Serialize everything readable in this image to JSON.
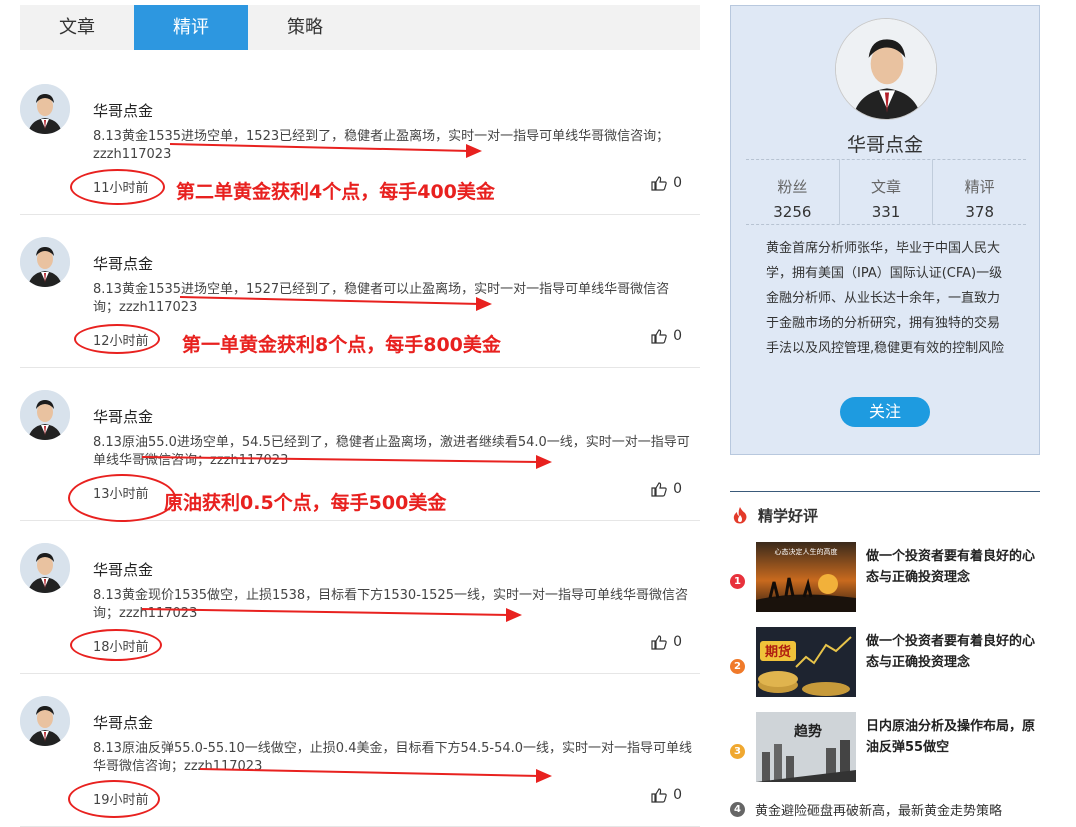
{
  "tabs": [
    "文章",
    "精评",
    "策略"
  ],
  "posts": [
    {
      "author": "华哥点金",
      "content": "8.13黄金1535进场空单，1523已经到了，稳健者止盈离场，实时一对一指导可单线华哥微信咨询；zzzh117023",
      "time": "11小时前",
      "likes": "0",
      "note": "第二单黄金获利4个点，每手400美金"
    },
    {
      "author": "华哥点金",
      "content": "8.13黄金1535进场空单，1527已经到了，稳健者可以止盈离场，实时一对一指导可单线华哥微信咨询；zzzh117023",
      "time": "12小时前",
      "likes": "0",
      "note": "第一单黄金获利8个点，每手800美金"
    },
    {
      "author": "华哥点金",
      "content": "8.13原油55.0进场空单，54.5已经到了，稳健者止盈离场，激进者继续看54.0一线，实时一对一指导可单线华哥微信咨询；zzzh117023",
      "time": "13小时前",
      "likes": "0",
      "note": "原油获利0.5个点，每手500美金"
    },
    {
      "author": "华哥点金",
      "content": "8.13黄金现价1535做空，止损1538，目标看下方1530-1525一线，实时一对一指导可单线华哥微信咨询；zzzh117023",
      "time": "18小时前",
      "likes": "0",
      "note": ""
    },
    {
      "author": "华哥点金",
      "content": "8.13原油反弹55.0-55.10一线做空，止损0.4美金，目标看下方54.5-54.0一线，实时一对一指导可单线华哥微信咨询；zzzh117023",
      "time": "19小时前",
      "likes": "0",
      "note": ""
    }
  ],
  "profile": {
    "name": "华哥点金",
    "stats": [
      {
        "label": "粉丝",
        "value": "3256"
      },
      {
        "label": "文章",
        "value": "331"
      },
      {
        "label": "精评",
        "value": "378"
      }
    ],
    "bio": "黄金首席分析师张华，毕业于中国人民大学，拥有美国（IPA）国际认证(CFA)一级金融分析师、从业长达十余年，一直致力于金融市场的分析研究，拥有独特的交易手法以及风控管理,稳健更有效的控制风险",
    "follow_label": "关注"
  },
  "hot": {
    "title": "精学好评",
    "items": [
      {
        "rank": "1",
        "text": "做一个投资者要有着良好的心态与正确投资理念",
        "thumb_caption": "心态决定人生的高度",
        "color": "#e8323c"
      },
      {
        "rank": "2",
        "text": "做一个投资者要有着良好的心态与正确投资理念",
        "thumb_caption": "期货",
        "color": "#f07a2a"
      },
      {
        "rank": "3",
        "text": "日内原油分析及操作布局，原油反弹55做空",
        "thumb_caption": "趋势",
        "color": "#f0a830"
      }
    ],
    "last": {
      "rank": "4",
      "text": "黄金避险砸盘再破新高，最新黄金走势策略"
    }
  }
}
